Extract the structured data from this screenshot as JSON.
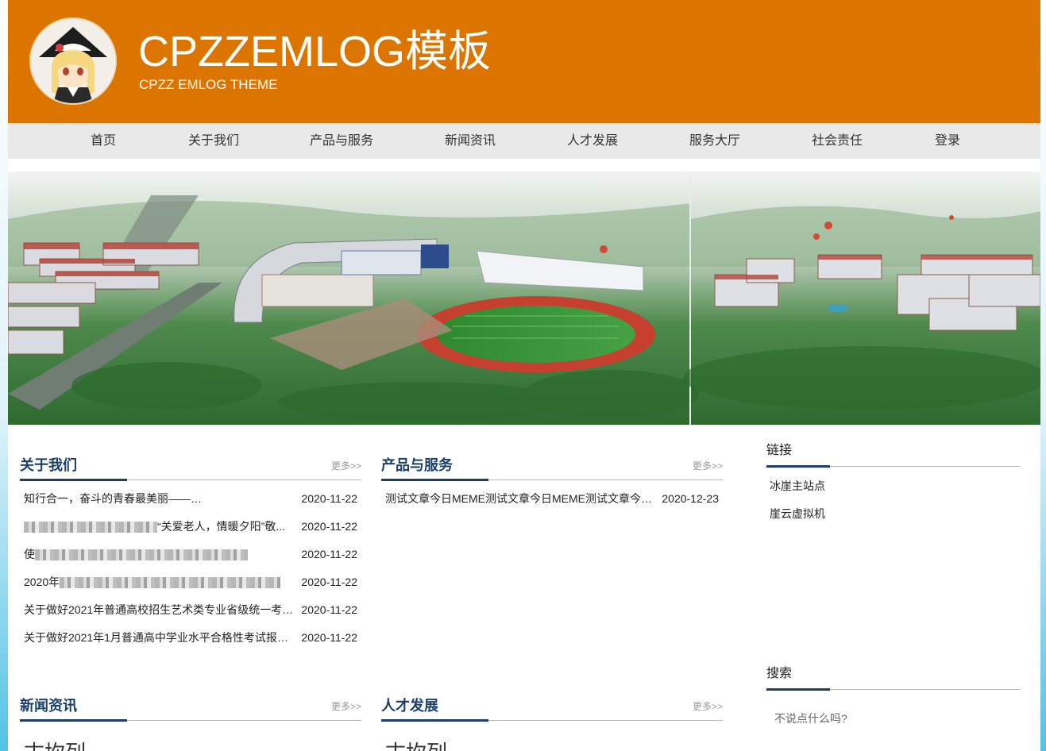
{
  "header": {
    "title": "CPZZEMLOG模板",
    "subtitle": "CPZZ EMLOG THEME"
  },
  "colors": {
    "header_bg": "#dc7400",
    "nav_bg": "#e9e9e9",
    "accent": "#1b3f66"
  },
  "nav": {
    "items": [
      {
        "label": "首页"
      },
      {
        "label": "关于我们"
      },
      {
        "label": "产品与服务"
      },
      {
        "label": "新闻资讯"
      },
      {
        "label": "人才发展"
      },
      {
        "label": "服务大厅"
      },
      {
        "label": "社会责任"
      },
      {
        "label": "登录"
      }
    ]
  },
  "about": {
    "title": "关于我们",
    "more": "更多>>",
    "items": [
      {
        "title": "知行合一，奋斗的青春最美丽——",
        "title_end": "，...",
        "date": "2020-11-22"
      },
      {
        "title": "“关爱老人，情暖夕阳”敬...",
        "date": "2020-11-22"
      },
      {
        "title": "使",
        "date": "2020-11-22"
      },
      {
        "title": "2020年",
        "date": "2020-11-22"
      },
      {
        "title": "关于做好2021年普通高校招生艺术类专业省级统一考试...",
        "date": "2020-11-22"
      },
      {
        "title": "关于做好2021年1月普通高中学业水平合格性考试报名考...",
        "date": "2020-11-22"
      }
    ]
  },
  "products": {
    "title": "产品与服务",
    "more": "更多>>",
    "items": [
      {
        "title": "测试文章今日MEME测试文章今日MEME测试文章今日M...",
        "date": "2020-12-23"
      }
    ]
  },
  "news": {
    "title": "新闻资讯",
    "more": "更多>>",
    "cut_text": "古坎列"
  },
  "talent": {
    "title": "人才发展",
    "more": "更多>>",
    "cut_text": "古坎列"
  },
  "links": {
    "title": "链接",
    "items": [
      {
        "label": "冰崖主站点"
      },
      {
        "label": "崖云虚拟机"
      }
    ]
  },
  "search": {
    "title": "搜索",
    "placeholder": "不说点什么吗?"
  }
}
